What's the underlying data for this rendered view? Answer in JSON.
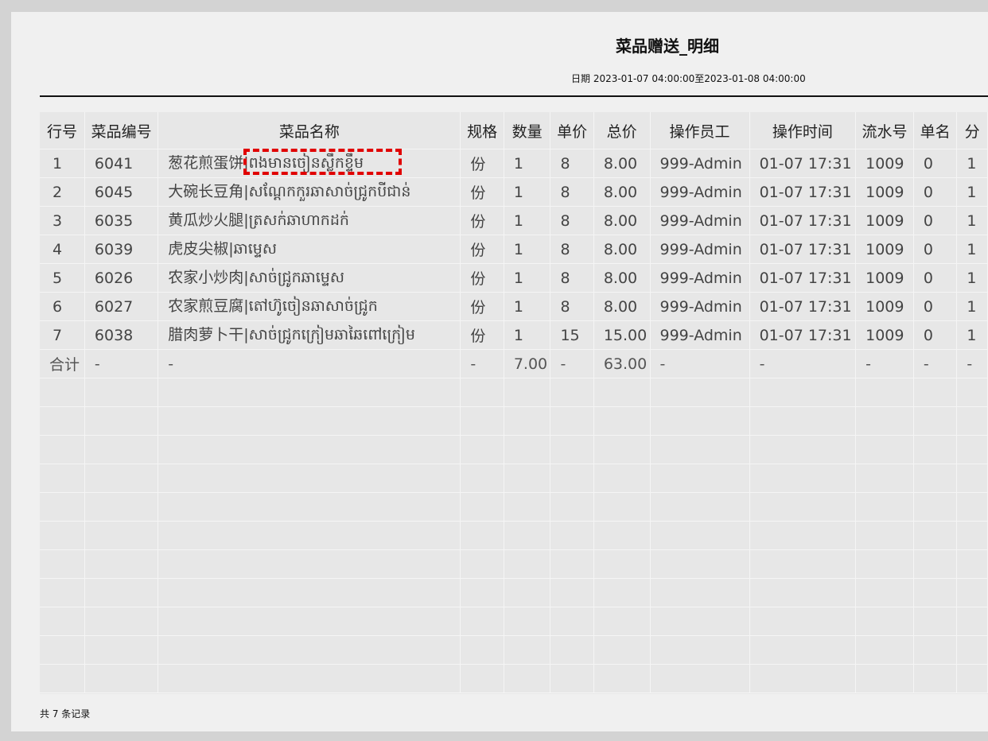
{
  "report": {
    "title": "菜品赠送_明细",
    "date_range": "日期 2023-01-07 04:00:00至2023-01-08 04:00:00",
    "footer": "共 7 条记录"
  },
  "table": {
    "headers": [
      "行号",
      "菜品编号",
      "菜品名称",
      "规格",
      "数量",
      "单价",
      "总价",
      "操作员工",
      "操作时间",
      "流水号",
      "单名",
      "分"
    ],
    "rows": [
      [
        "1",
        "6041",
        "葱花煎蛋饼|ពងមានចៀនស្លឹកខ្ទឹម",
        "份",
        "1",
        "8",
        "8.00",
        "999-Admin",
        "01-07 17:31",
        "1009",
        "0",
        "1"
      ],
      [
        "2",
        "6045",
        "大碗长豆角|សណ្ដែកកួរឆាសាច់ជ្រូកបីជាន់",
        "份",
        "1",
        "8",
        "8.00",
        "999-Admin",
        "01-07 17:31",
        "1009",
        "0",
        "1"
      ],
      [
        "3",
        "6035",
        "黄瓜炒火腿|ត្រសក់ឆាហាកដក់",
        "份",
        "1",
        "8",
        "8.00",
        "999-Admin",
        "01-07 17:31",
        "1009",
        "0",
        "1"
      ],
      [
        "4",
        "6039",
        "虎皮尖椒|ឆាម្ទេស",
        "份",
        "1",
        "8",
        "8.00",
        "999-Admin",
        "01-07 17:31",
        "1009",
        "0",
        "1"
      ],
      [
        "5",
        "6026",
        "农家小炒肉|សាច់ជ្រូកឆាម្ទេស",
        "份",
        "1",
        "8",
        "8.00",
        "999-Admin",
        "01-07 17:31",
        "1009",
        "0",
        "1"
      ],
      [
        "6",
        "6027",
        "农家煎豆腐|តៅហ៊ូចៀនឆាសាច់ជ្រូក",
        "份",
        "1",
        "8",
        "8.00",
        "999-Admin",
        "01-07 17:31",
        "1009",
        "0",
        "1"
      ],
      [
        "7",
        "6038",
        "腊肉萝卜干|សាច់ជ្រូកក្រៀមឆាឆៃពៅក្រៀម",
        "份",
        "1",
        "15",
        "15.00",
        "999-Admin",
        "01-07 17:31",
        "1009",
        "0",
        "1"
      ]
    ],
    "total_row": [
      "合计",
      "-",
      "-",
      "-",
      "7.00",
      "-",
      "63.00",
      "-",
      "-",
      "-",
      "-",
      "-"
    ],
    "empty_rows": 11
  }
}
